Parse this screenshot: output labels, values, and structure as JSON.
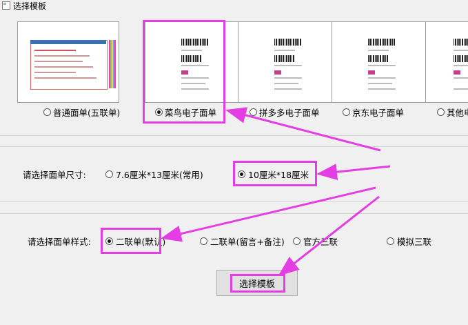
{
  "window": {
    "title": "选择模板"
  },
  "templates": [
    {
      "label": "普通面单(五联单)",
      "selected": false
    },
    {
      "label": "菜鸟电子面单",
      "selected": true
    },
    {
      "label": "拼多多电子面单",
      "selected": false
    },
    {
      "label": "京东电子面单",
      "selected": false
    },
    {
      "label": "其他电",
      "selected": false
    }
  ],
  "size": {
    "label": "请选择面单尺寸:",
    "options": [
      {
        "label": "7.6厘米*13厘米(常用)",
        "selected": false
      },
      {
        "label": "10厘米*18厘米",
        "selected": true
      }
    ]
  },
  "style": {
    "label": "请选择面单样式:",
    "options": [
      {
        "label": "二联单(默认)",
        "selected": true
      },
      {
        "label": "二联单(留言+备注)",
        "selected": false
      },
      {
        "label": "官方三联",
        "selected": false
      },
      {
        "label": "模拟三联",
        "selected": false
      }
    ]
  },
  "button": {
    "label": "选择模板"
  },
  "colors": {
    "highlight": "#e43de4",
    "arrow": "#e43de4"
  }
}
